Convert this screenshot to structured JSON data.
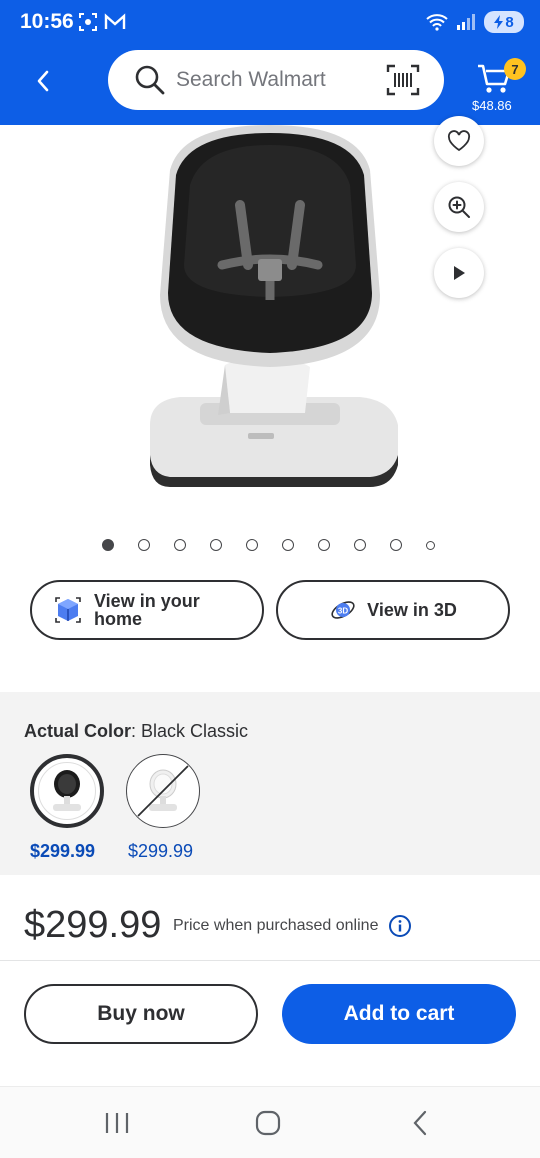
{
  "status_bar": {
    "time": "10:56",
    "battery": "8",
    "network": "6"
  },
  "header": {
    "search_placeholder": "Search Walmart",
    "cart_count": "7",
    "cart_total": "$48.86"
  },
  "gallery": {
    "image_count": 10,
    "active_index": 0
  },
  "view_buttons": {
    "home_label_line1": "View in your",
    "home_label_line2": "home",
    "three_d_label": "View in 3D"
  },
  "color": {
    "label": "Actual Color",
    "value": ": Black Classic",
    "options": [
      {
        "price": "$299.99",
        "selected": true,
        "available": true
      },
      {
        "price": "$299.99",
        "selected": false,
        "available": false
      }
    ]
  },
  "price": {
    "amount": "$299.99",
    "note": "Price when purchased online"
  },
  "actions": {
    "buy_now": "Buy now",
    "add_to_cart": "Add to cart"
  },
  "colors": {
    "brand_blue": "#0d5ee6",
    "badge_yellow": "#ffc220",
    "price_blue": "#0b4bb7"
  }
}
